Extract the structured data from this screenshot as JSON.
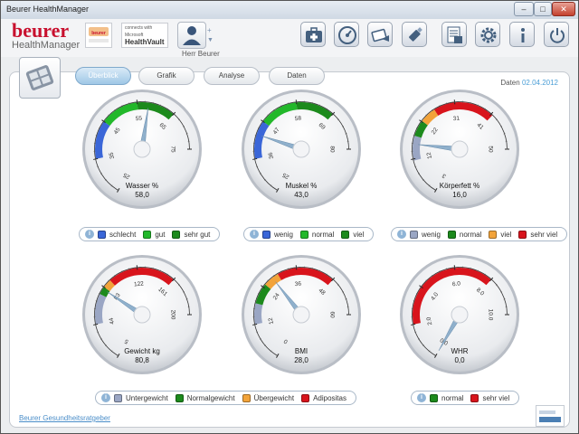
{
  "window": {
    "title": "Beurer HealthManager"
  },
  "brand": {
    "name": "beurer",
    "product": "HealthManager"
  },
  "healthvault": {
    "line1": "connects with",
    "line2": "Microsoft",
    "line3": "HealthVault"
  },
  "user": {
    "name": "Herr Beurer"
  },
  "tabs": [
    "Überblick",
    "Grafik",
    "Analyse",
    "Daten"
  ],
  "date": {
    "label": "Daten",
    "value": "02.04.2012"
  },
  "colors": {
    "blue": "#3a66d8",
    "green": "#22b82a",
    "darkgreen": "#1c8a1c",
    "red": "#d8141c",
    "orange": "#f2a33a",
    "grey": "#9aa6c4"
  },
  "gauges": [
    {
      "id": "wasser",
      "label": "Wasser %",
      "value": "58,0",
      "numeric": 58,
      "min": 25,
      "max": 75,
      "ticks": [
        "25",
        "35",
        "45",
        "55",
        "65",
        "75"
      ],
      "segments": [
        {
          "from": 35,
          "to": 45,
          "color": "blue"
        },
        {
          "from": 45,
          "to": 55,
          "color": "green"
        },
        {
          "from": 55,
          "to": 65,
          "color": "darkgreen"
        }
      ]
    },
    {
      "id": "muskel",
      "label": "Muskel %",
      "value": "43,0",
      "numeric": 43,
      "min": 25,
      "max": 80,
      "ticks": [
        "25",
        "36",
        "47",
        "58",
        "69",
        "80"
      ],
      "segments": [
        {
          "from": 36,
          "to": 47,
          "color": "blue"
        },
        {
          "from": 47,
          "to": 58,
          "color": "green"
        },
        {
          "from": 58,
          "to": 69,
          "color": "darkgreen"
        }
      ]
    },
    {
      "id": "koerperfett",
      "label": "Körperfett %",
      "value": "16,0",
      "numeric": 16,
      "min": 3,
      "max": 50,
      "ticks": [
        "3",
        "12",
        "22",
        "31",
        "41",
        "50"
      ],
      "segments": [
        {
          "from": 12,
          "to": 18,
          "color": "grey"
        },
        {
          "from": 18,
          "to": 22,
          "color": "darkgreen"
        },
        {
          "from": 22,
          "to": 26,
          "color": "orange"
        },
        {
          "from": 26,
          "to": 41,
          "color": "red"
        }
      ]
    },
    {
      "id": "gewicht",
      "label": "Gewicht kg",
      "value": "80,8",
      "numeric": 80.8,
      "min": 5,
      "max": 200,
      "ticks": [
        "5",
        "44",
        "83",
        "122",
        "161",
        "200"
      ],
      "segments": [
        {
          "from": 44,
          "to": 75,
          "color": "grey"
        },
        {
          "from": 75,
          "to": 83,
          "color": "darkgreen"
        },
        {
          "from": 83,
          "to": 92,
          "color": "orange"
        },
        {
          "from": 92,
          "to": 161,
          "color": "red"
        }
      ]
    },
    {
      "id": "bmi",
      "label": "BMI",
      "value": "28,0",
      "numeric": 28,
      "min": 0,
      "max": 60,
      "ticks": [
        "0",
        "12",
        "24",
        "36",
        "48",
        "60"
      ],
      "segments": [
        {
          "from": 12,
          "to": 18.5,
          "color": "grey"
        },
        {
          "from": 18.5,
          "to": 25,
          "color": "darkgreen"
        },
        {
          "from": 25,
          "to": 30,
          "color": "orange"
        },
        {
          "from": 30,
          "to": 48,
          "color": "red"
        }
      ]
    },
    {
      "id": "whr",
      "label": "WHR",
      "value": "0,0",
      "numeric": 0,
      "min": 0,
      "max": 10,
      "ticks": [
        "0.0",
        "2.0",
        "4.0",
        "6.0",
        "8.0",
        "10.0"
      ],
      "segments": [
        {
          "from": 2,
          "to": 8,
          "color": "red"
        }
      ]
    }
  ],
  "legends": {
    "wasser": [
      {
        "label": "schlecht",
        "color": "blue"
      },
      {
        "label": "gut",
        "color": "green"
      },
      {
        "label": "sehr gut",
        "color": "darkgreen"
      }
    ],
    "muskel": [
      {
        "label": "wenig",
        "color": "blue"
      },
      {
        "label": "normal",
        "color": "green"
      },
      {
        "label": "viel",
        "color": "darkgreen"
      }
    ],
    "koerperfett": [
      {
        "label": "wenig",
        "color": "grey"
      },
      {
        "label": "normal",
        "color": "darkgreen"
      },
      {
        "label": "viel",
        "color": "orange"
      },
      {
        "label": "sehr viel",
        "color": "red"
      }
    ],
    "bottom": [
      {
        "label": "Untergewicht",
        "color": "grey"
      },
      {
        "label": "Normalgewicht",
        "color": "darkgreen"
      },
      {
        "label": "Übergewicht",
        "color": "orange"
      },
      {
        "label": "Adipositas",
        "color": "red"
      }
    ],
    "whr": [
      {
        "label": "normal",
        "color": "darkgreen"
      },
      {
        "label": "sehr viel",
        "color": "red"
      }
    ]
  },
  "footer": {
    "link": "Beurer Gesundheitsratgeber"
  },
  "toolbar_icons": [
    "first-aid-kit-icon",
    "speedometer-icon",
    "sync-device-icon",
    "usb-stick-icon",
    "notes-icon",
    "settings-gear-icon",
    "info-icon",
    "power-icon"
  ]
}
